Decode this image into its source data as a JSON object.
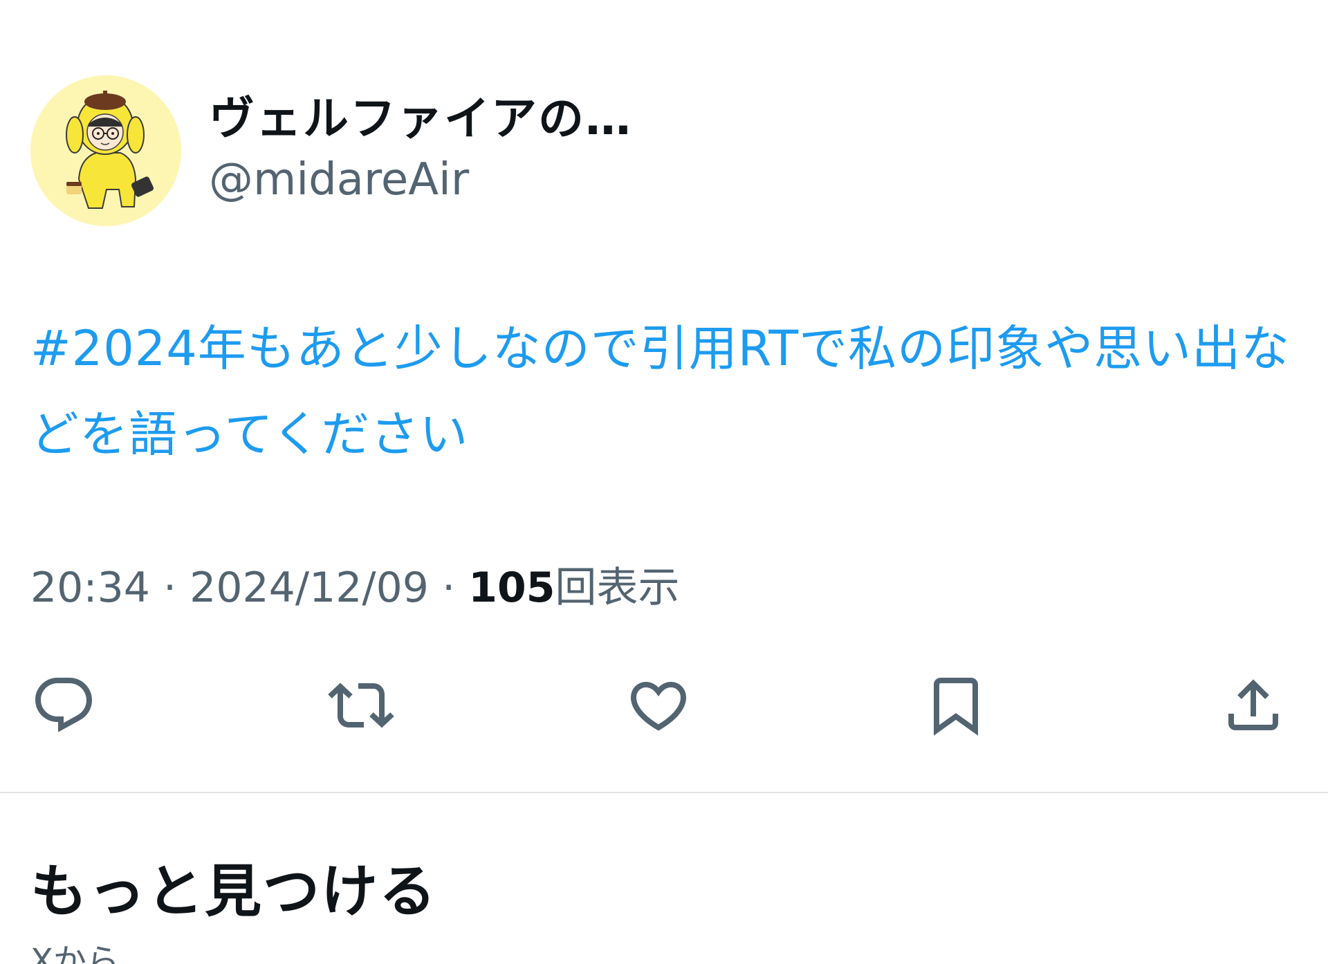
{
  "author": {
    "display_name": "ヴェルファイアの…",
    "handle": "@midareAir"
  },
  "tweet": {
    "text": "#2024年もあと少しなので引用RTで私の印象や思い出などを語ってください"
  },
  "meta": {
    "time": "20:34",
    "separator": "·",
    "date": "2024/12/09",
    "views_count": "105",
    "views_label": "回表示"
  },
  "actions": [
    {
      "icon": "reply-icon"
    },
    {
      "icon": "retweet-icon"
    },
    {
      "icon": "like-icon"
    },
    {
      "icon": "bookmark-icon"
    },
    {
      "icon": "share-icon"
    }
  ],
  "discover": {
    "title": "もっと見つける",
    "subtitle": "Xから"
  },
  "colors": {
    "link": "#1d9bf0",
    "secondary_text": "#536471",
    "primary_text": "#0f1419",
    "avatar_background": "#fdf6b3"
  }
}
